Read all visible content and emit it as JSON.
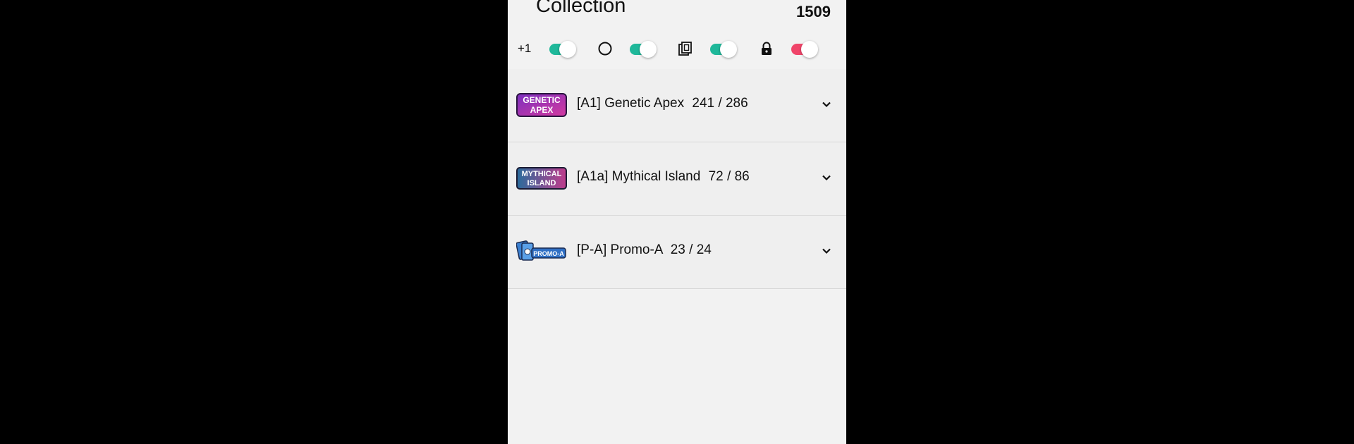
{
  "header": {
    "title": "Collection",
    "count": "1509"
  },
  "filters": [
    {
      "id": "plus-one",
      "label": "+1",
      "icon": "plus-one-text",
      "enabled": true,
      "color": "#1fb89a"
    },
    {
      "id": "circle",
      "label": "",
      "icon": "circle-icon",
      "enabled": true,
      "color": "#1fb89a"
    },
    {
      "id": "cards",
      "label": "",
      "icon": "card-stack-icon",
      "enabled": true,
      "color": "#1fb89a"
    },
    {
      "id": "lock",
      "label": "",
      "icon": "lock-icon",
      "enabled": true,
      "color": "#f0456a"
    }
  ],
  "sets": [
    {
      "code": "[A1]",
      "name": "Genetic Apex",
      "progress": "241 / 286",
      "owned": 241,
      "total": 286,
      "logo": "genetic-apex-logo",
      "logo_text": [
        "GENETIC",
        "APEX"
      ]
    },
    {
      "code": "[A1a]",
      "name": "Mythical Island",
      "progress": "72 / 86",
      "owned": 72,
      "total": 86,
      "logo": "mythical-island-logo",
      "logo_text": [
        "MYTHICAL",
        "ISLAND"
      ]
    },
    {
      "code": "[P-A]",
      "name": "Promo-A",
      "progress": "23 / 24",
      "owned": 23,
      "total": 24,
      "logo": "promo-a-logo",
      "logo_text": [
        "PROMO-A"
      ]
    }
  ]
}
